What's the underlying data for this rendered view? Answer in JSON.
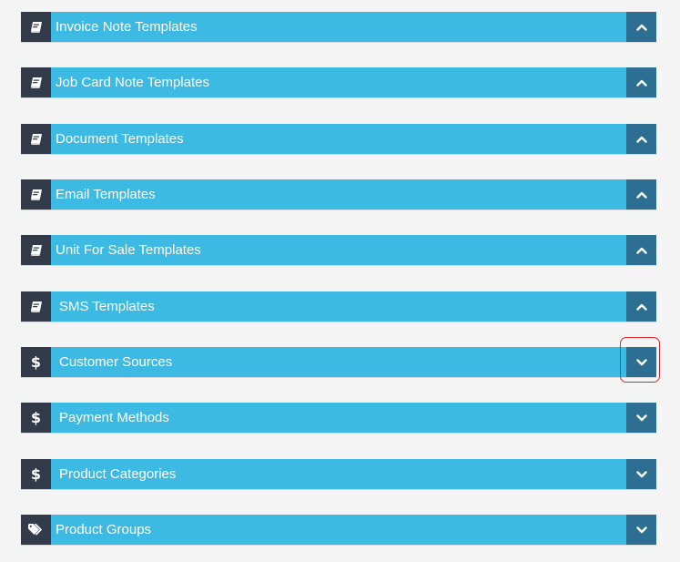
{
  "panels": [
    {
      "title": "Invoice Note Templates",
      "icon": "book-icon",
      "toggle": "chevron-up-icon"
    },
    {
      "title": "Job Card Note Templates",
      "icon": "book-icon",
      "toggle": "chevron-up-icon"
    },
    {
      "title": "Document Templates",
      "icon": "book-icon",
      "toggle": "chevron-up-icon"
    },
    {
      "title": "Email Templates",
      "icon": "book-icon",
      "toggle": "chevron-up-icon"
    },
    {
      "title": "Unit For Sale Templates",
      "icon": "book-icon",
      "toggle": "chevron-up-icon"
    },
    {
      "title": "SMS Templates",
      "icon": "book-icon",
      "toggle": "chevron-up-icon"
    },
    {
      "title": "Customer Sources",
      "icon": "dollar-icon",
      "toggle": "chevron-down-icon",
      "highlighted": true
    },
    {
      "title": "Payment Methods",
      "icon": "dollar-icon",
      "toggle": "chevron-down-icon"
    },
    {
      "title": "Product Categories",
      "icon": "dollar-icon",
      "toggle": "chevron-down-icon"
    },
    {
      "title": "Product Groups",
      "icon": "tags-icon",
      "toggle": "chevron-down-icon"
    }
  ],
  "colors": {
    "header_bg": "#3dbae3",
    "icon_bg": "#333b4a",
    "toggle_bg": "#2d6e93",
    "highlight": "#e0242b"
  }
}
